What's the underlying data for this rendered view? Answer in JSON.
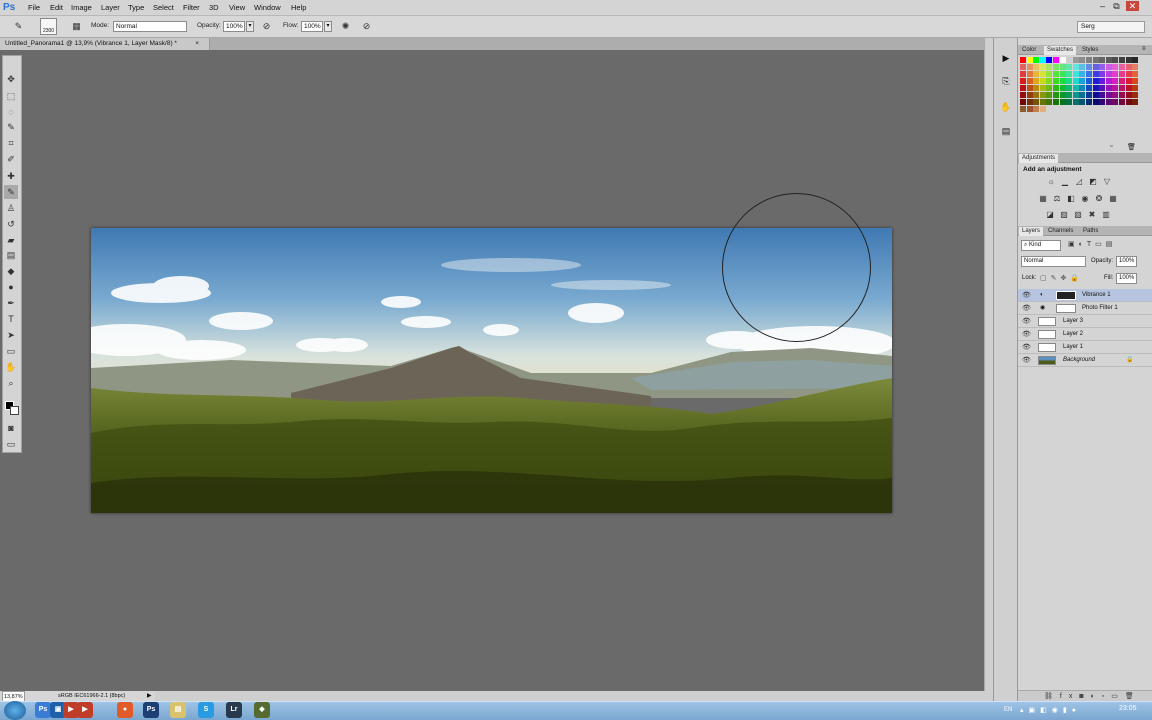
{
  "app": {
    "logo": "Ps"
  },
  "menu": [
    "File",
    "Edit",
    "Image",
    "Layer",
    "Type",
    "Select",
    "Filter",
    "3D",
    "View",
    "Window",
    "Help"
  ],
  "window_controls": [
    "–",
    "⧉",
    "✕"
  ],
  "workspace": {
    "value": "Serg"
  },
  "options_bar": {
    "brush_size": "2300",
    "mode_label": "Mode:",
    "mode_value": "Normal",
    "opacity_label": "Opacity:",
    "opacity_value": "100%",
    "flow_label": "Flow:",
    "flow_value": "100%"
  },
  "document": {
    "tab_title": "Untitled_Panorama1 @ 13,9% (Vibrance 1, Layer Mask/8) *",
    "close": "×"
  },
  "status": {
    "zoom": "13,87%",
    "profile": "sRGB IEC61966-2.1 (8bpc)"
  },
  "panels": {
    "color_tabs": [
      "Color",
      "Swatches",
      "Styles"
    ],
    "adjustments_tab": "Adjustments",
    "adjustments_title": "Add an adjustment",
    "layers_tabs": [
      "Layers",
      "Channels",
      "Paths"
    ],
    "kind_filter": "Kind",
    "blend_mode": "Normal",
    "opacity_label": "Opacity:",
    "opacity_value": "100%",
    "lock_label": "Lock:",
    "fill_label": "Fill:",
    "fill_value": "100%",
    "layers": [
      {
        "name": "Vibrance 1",
        "selected": true
      },
      {
        "name": "Photo Filter 1",
        "selected": false
      },
      {
        "name": "Layer 3",
        "selected": false
      },
      {
        "name": "Layer 2",
        "selected": false
      },
      {
        "name": "Layer 1",
        "selected": false
      },
      {
        "name": "Background",
        "selected": false
      }
    ]
  },
  "taskbar": {
    "lang": "EN",
    "time": "23:05"
  },
  "colors": {
    "accent": "#2a6fd6",
    "selected_layer": "#b6c4e0",
    "canvas_bg": "#6a6a6a"
  }
}
